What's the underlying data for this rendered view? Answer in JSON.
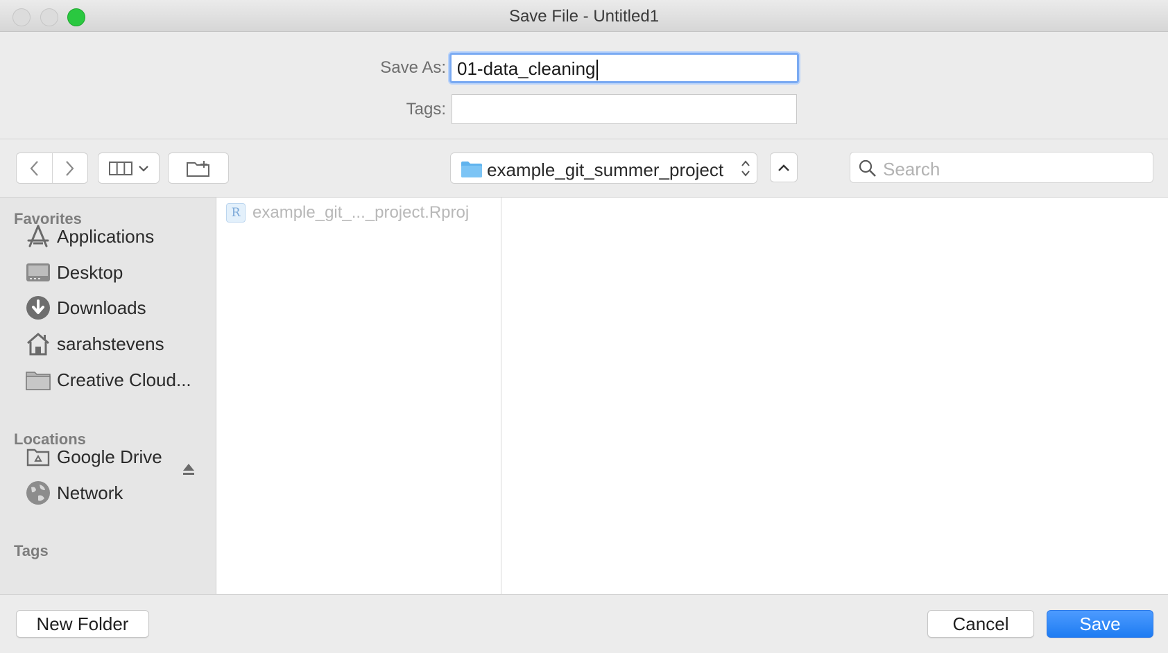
{
  "window": {
    "title": "Save File - Untitled1"
  },
  "form": {
    "save_as_label": "Save As:",
    "save_as_value": "01-data_cleaning",
    "tags_label": "Tags:",
    "tags_value": ""
  },
  "toolbar": {
    "path": "example_git_summer_project",
    "search_placeholder": "Search"
  },
  "sidebar": {
    "favorites_header": "Favorites",
    "favorites": [
      {
        "label": "Applications",
        "icon": "applications-icon"
      },
      {
        "label": "Desktop",
        "icon": "desktop-icon"
      },
      {
        "label": "Downloads",
        "icon": "downloads-icon"
      },
      {
        "label": "sarahstevens",
        "icon": "home-icon"
      },
      {
        "label": "Creative Cloud...",
        "icon": "folder-icon"
      }
    ],
    "locations_header": "Locations",
    "locations": [
      {
        "label": "Google Drive",
        "icon": "drive-folder-icon"
      },
      {
        "label": "Network",
        "icon": "network-globe-icon"
      }
    ],
    "tags_header": "Tags"
  },
  "files": [
    {
      "name": "example_git_..._project.Rproj",
      "icon_letter": "R"
    }
  ],
  "buttons": {
    "new_folder": "New Folder",
    "cancel": "Cancel",
    "save": "Save"
  },
  "colors": {
    "accent": "#1e7cf2",
    "focus_ring": "#7aaaf2",
    "folder": "#5fb3ee"
  }
}
